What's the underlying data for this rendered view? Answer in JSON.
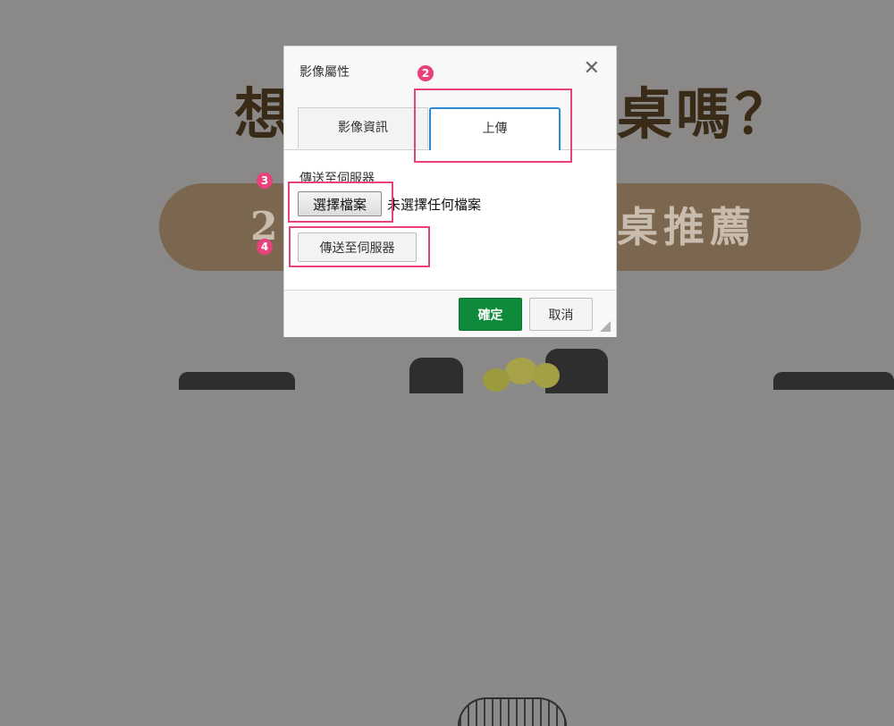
{
  "background": {
    "headline_left": "想",
    "headline_right": "桌嗎？",
    "pill_left": "2",
    "pill_right": "桌推薦"
  },
  "dialog": {
    "title": "影像屬性",
    "close_glyph": "✕",
    "tabs": [
      {
        "label": "影像資訊",
        "active": false
      },
      {
        "label": "上傳",
        "active": true
      }
    ],
    "upload_label": "傳送至伺服器",
    "file_button_label": "選擇檔案",
    "file_status": "未選擇任何檔案",
    "send_button_label": "傳送至伺服器",
    "ok_label": "確定",
    "cancel_label": "取消"
  },
  "annotations": {
    "markers": [
      "2",
      "3",
      "4"
    ],
    "highlight_color": "#e8417c"
  },
  "colors": {
    "accent_tab": "#2b8ad8",
    "ok_button": "#0f8a3a"
  }
}
